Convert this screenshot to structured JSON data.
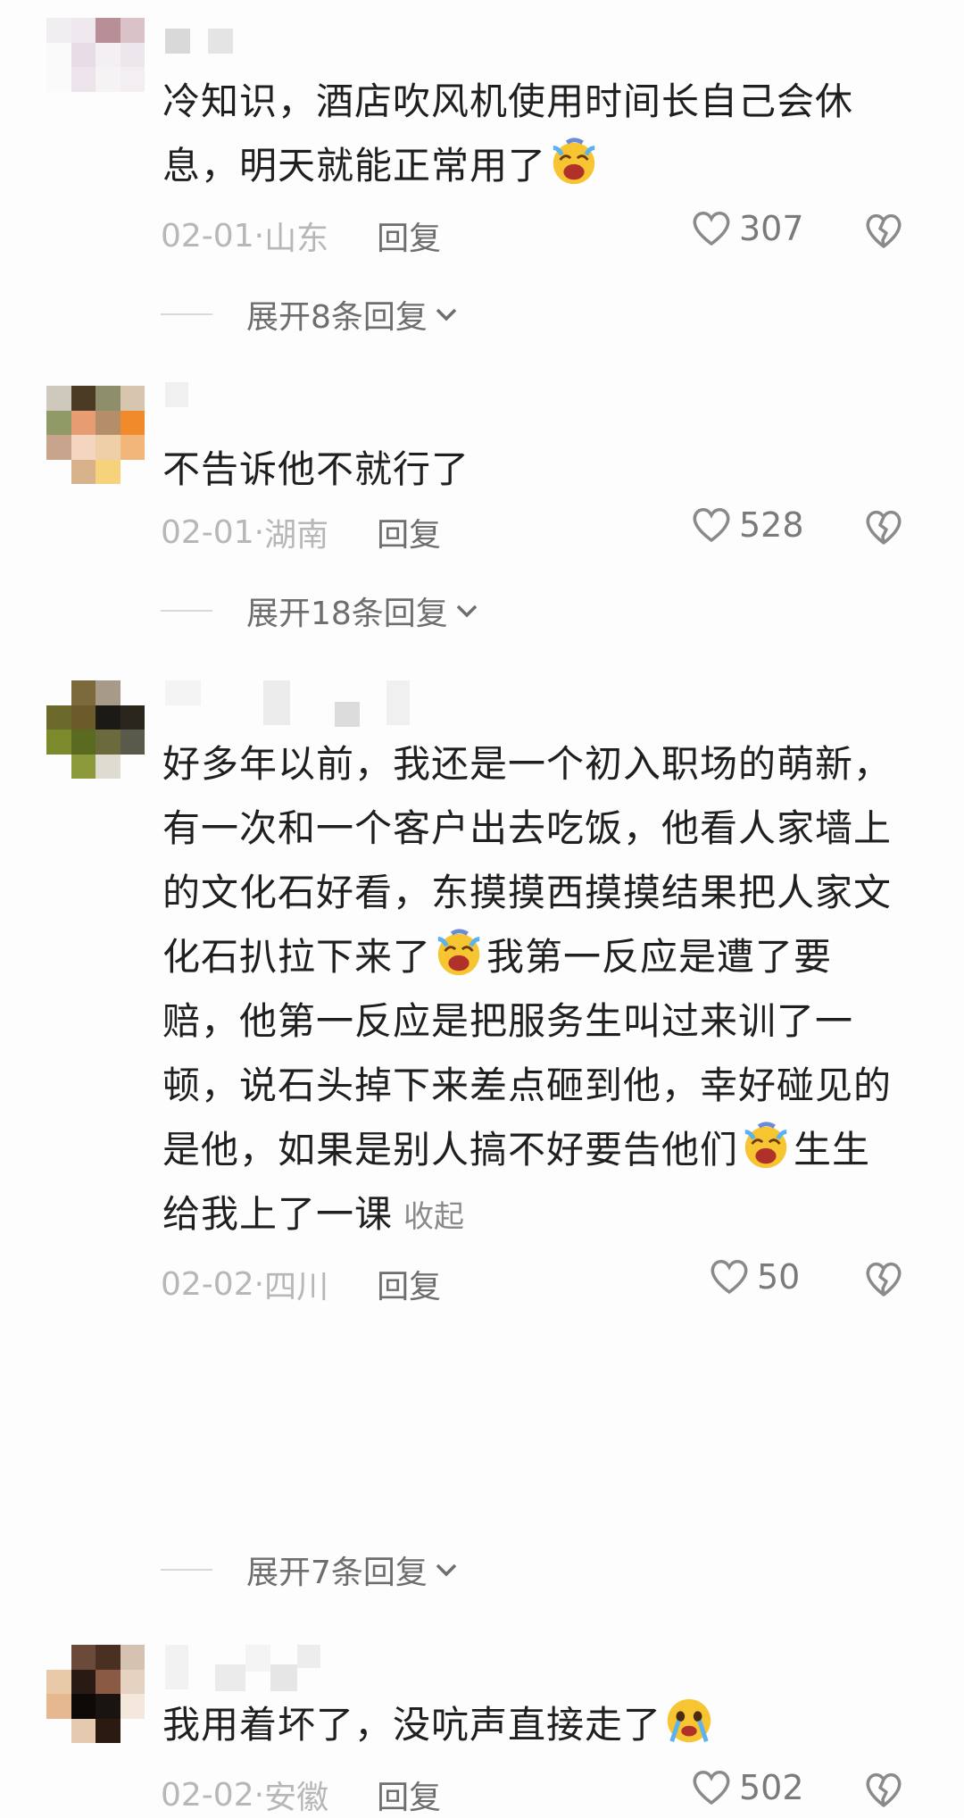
{
  "comments": [
    {
      "text": "冷知识，酒店吹风机使用时间长自己会休息，明天就能正常用了",
      "date": "02-01",
      "location": "山东",
      "reply_label": "回复",
      "likes": "307",
      "emoji": "laugh-cry-emoji"
    },
    {
      "text": "不告诉他不就行了",
      "date": "02-01",
      "location": "湖南",
      "reply_label": "回复",
      "likes": "528"
    },
    {
      "text_part1": "好多年以前，我还是一个初入职场的萌新，有一次和一个客户出去吃饭，他看人家墙上的文化石好看，东摸摸西摸摸结果把人家文化石扒拉下来了",
      "text_part2": "我第一反应是遭了要赔，他第一反应是把服务生叫过来训了一顿，说石头掉下来差点砸到他，幸好碰见的是他，如果是别人搞不好要告他们",
      "text_part3": "生生给我上了一课",
      "collapse_label": "收起",
      "date": "02-02",
      "location": "四川",
      "reply_label": "回复",
      "likes": "50"
    },
    {
      "text": "我用着坏了，没吭声直接走了",
      "date": "02-02",
      "location": "安徽",
      "reply_label": "回复",
      "likes": "502",
      "emoji": "crying-emoji"
    }
  ],
  "expand_labels": [
    "展开8条回复",
    "展开18条回复",
    "展开7条回复"
  ],
  "separator": " · ",
  "colors": {
    "background": "#fdfdfd",
    "text": "#1f1f1f",
    "meta": "#b7b7b7",
    "reply": "#6e6e6e"
  }
}
